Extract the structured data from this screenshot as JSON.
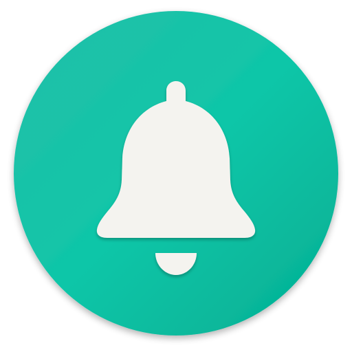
{
  "icon": {
    "name": "bell-icon",
    "colors": {
      "circle_light": "#25bfa9",
      "circle_mid": "#0fc6a8",
      "circle_dark": "#02ae92",
      "bell": "#f4f3ef",
      "shadow": "#000000"
    }
  }
}
